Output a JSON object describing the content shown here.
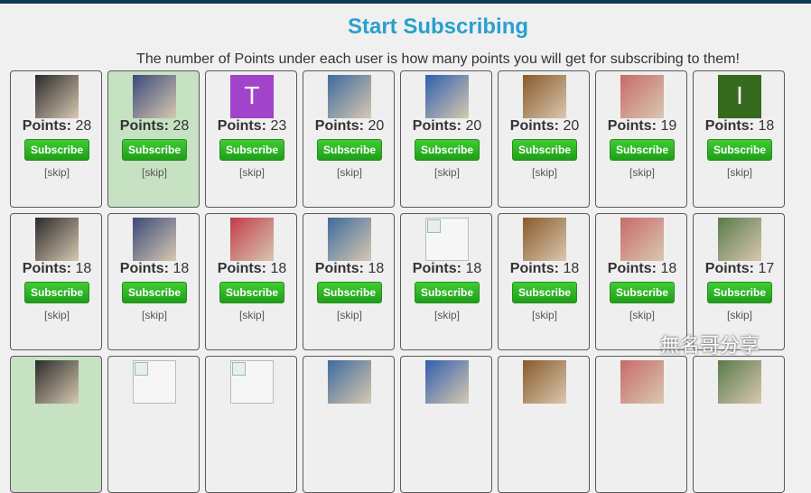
{
  "header": {
    "title": "Start Subscribing",
    "subtitle": "The number of Points under each user is how many points you will get for subscribing to them!"
  },
  "labels": {
    "points": "Points:",
    "subscribe": "Subscribe",
    "skip": "[skip]"
  },
  "colors": {
    "title": "#2a9fce",
    "button": "#27b11f",
    "highlight": "#c6e2c2"
  },
  "watermark": "無名哥分享",
  "cards": [
    {
      "points": "28",
      "avatar": "photo",
      "highlighted": false
    },
    {
      "points": "28",
      "avatar": "photo",
      "highlighted": true
    },
    {
      "points": "23",
      "avatar": "letter",
      "letter": "T",
      "color": "#a144c9",
      "highlighted": false
    },
    {
      "points": "20",
      "avatar": "photo",
      "highlighted": false
    },
    {
      "points": "20",
      "avatar": "photo",
      "highlighted": false
    },
    {
      "points": "20",
      "avatar": "photo",
      "highlighted": false
    },
    {
      "points": "19",
      "avatar": "photo",
      "highlighted": false
    },
    {
      "points": "18",
      "avatar": "letter",
      "letter": "I",
      "color": "#356a1f",
      "highlighted": false
    },
    {
      "points": "18",
      "avatar": "photo",
      "highlighted": false
    },
    {
      "points": "18",
      "avatar": "photo",
      "highlighted": false
    },
    {
      "points": "18",
      "avatar": "photo",
      "highlighted": false
    },
    {
      "points": "18",
      "avatar": "photo",
      "highlighted": false
    },
    {
      "points": "18",
      "avatar": "broken",
      "highlighted": false
    },
    {
      "points": "18",
      "avatar": "photo",
      "highlighted": false
    },
    {
      "points": "18",
      "avatar": "photo",
      "highlighted": false
    },
    {
      "points": "17",
      "avatar": "photo",
      "highlighted": false
    },
    {
      "avatar": "photo",
      "highlighted": true
    },
    {
      "avatar": "broken",
      "highlighted": false
    },
    {
      "avatar": "broken",
      "highlighted": false
    },
    {
      "avatar": "photo",
      "highlighted": false
    },
    {
      "avatar": "photo",
      "highlighted": false
    },
    {
      "avatar": "photo",
      "highlighted": false
    },
    {
      "avatar": "photo",
      "highlighted": false
    },
    {
      "avatar": "photo",
      "highlighted": false
    }
  ]
}
